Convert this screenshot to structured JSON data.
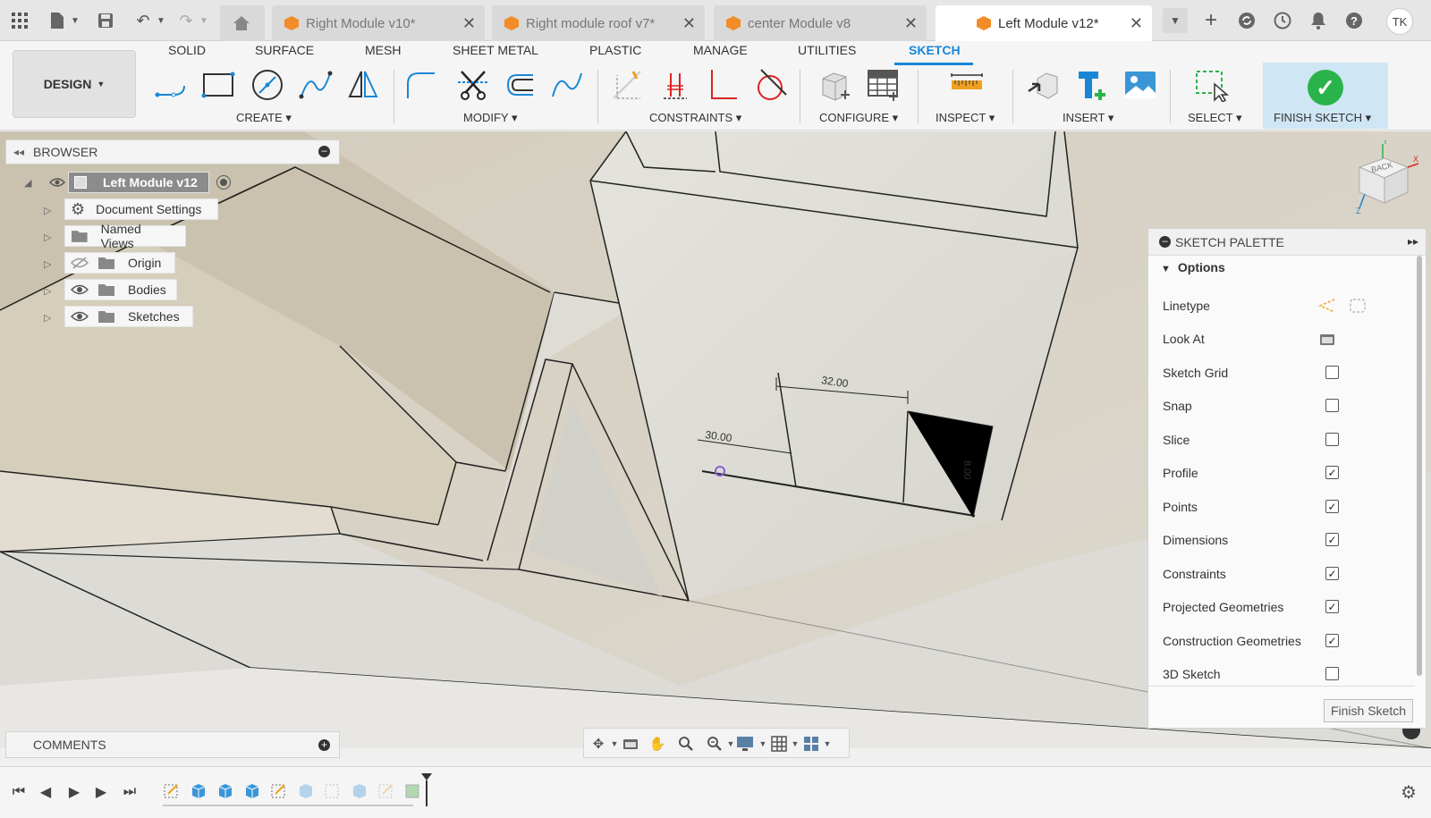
{
  "titlebar": {
    "tabs": [
      {
        "label": "Right Module v10*",
        "active": false
      },
      {
        "label": "Right module roof v7*",
        "active": false
      },
      {
        "label": "center Module v8",
        "active": false
      },
      {
        "label": "Left Module v12*",
        "active": true
      }
    ],
    "user_initials": "TK"
  },
  "ribbon": {
    "workspace_label": "DESIGN",
    "tabs": [
      "SOLID",
      "SURFACE",
      "MESH",
      "SHEET METAL",
      "PLASTIC",
      "MANAGE",
      "UTILITIES",
      "SKETCH"
    ],
    "active_tab": "SKETCH",
    "groups": {
      "create": "CREATE",
      "modify": "MODIFY",
      "constraints": "CONSTRAINTS",
      "configure": "CONFIGURE",
      "inspect": "INSPECT",
      "insert": "INSERT",
      "select": "SELECT",
      "finish": "FINISH SKETCH"
    }
  },
  "browser": {
    "title": "BROWSER",
    "root": "Left Module v12",
    "items": [
      "Document Settings",
      "Named Views",
      "Origin",
      "Bodies",
      "Sketches"
    ]
  },
  "palette": {
    "title": "SKETCH PALETTE",
    "section": "Options",
    "options": [
      {
        "label": "Linetype",
        "checked": null
      },
      {
        "label": "Look At",
        "checked": null
      },
      {
        "label": "Sketch Grid",
        "checked": false
      },
      {
        "label": "Snap",
        "checked": false
      },
      {
        "label": "Slice",
        "checked": false
      },
      {
        "label": "Profile",
        "checked": true
      },
      {
        "label": "Points",
        "checked": true
      },
      {
        "label": "Dimensions",
        "checked": true
      },
      {
        "label": "Constraints",
        "checked": true
      },
      {
        "label": "Projected Geometries",
        "checked": true
      },
      {
        "label": "Construction Geometries",
        "checked": true
      },
      {
        "label": "3D Sketch",
        "checked": false
      }
    ],
    "finish_button": "Finish Sketch"
  },
  "viewport": {
    "dimensions": [
      "32.00",
      "30.00",
      "8.00"
    ],
    "viewcube_face": "BACK"
  },
  "comments": {
    "title": "COMMENTS"
  }
}
